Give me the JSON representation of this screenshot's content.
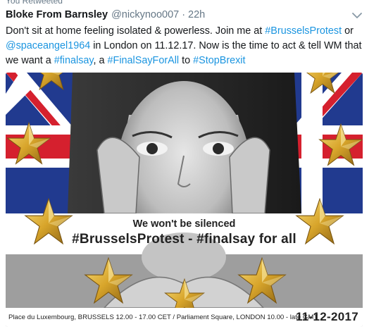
{
  "retweet_note": "You Retweeted",
  "tweet": {
    "author_name": "Bloke From Barnsley",
    "handle": "@nickynoo007",
    "separator": "·",
    "time": "22h",
    "text_parts": [
      {
        "t": "Don't sit at home feeling isolated & powerless. Join me at ",
        "link": false
      },
      {
        "t": "#BrusselsProtest",
        "link": true
      },
      {
        "t": " or ",
        "link": false
      },
      {
        "t": "@spaceangel1964",
        "link": true
      },
      {
        "t": " in London on 11.12.17. Now is the time to act & tell WM that we want a ",
        "link": false
      },
      {
        "t": "#finalsay",
        "link": true
      },
      {
        "t": ", a ",
        "link": false
      },
      {
        "t": "#FinalSayForAll",
        "link": true
      },
      {
        "t": " to ",
        "link": false
      },
      {
        "t": "#StopBrexit",
        "link": true
      }
    ]
  },
  "poster": {
    "line1": "We won't be silenced",
    "line2": "#BrusselsProtest - #finalsay for all",
    "footer_left": "Place du Luxembourg, BRUSSELS 12.00 - 17.00 CET / Parliament Square, LONDON 10.00 - late GMT",
    "footer_date": "11-12-2017"
  },
  "colors": {
    "link": "#1b95e0",
    "muted": "#657786",
    "union_red": "#d5202e",
    "union_blue": "#213a8f",
    "star_gold": "#d8a52b"
  },
  "icons": {
    "caret": "chevron-down-icon"
  }
}
